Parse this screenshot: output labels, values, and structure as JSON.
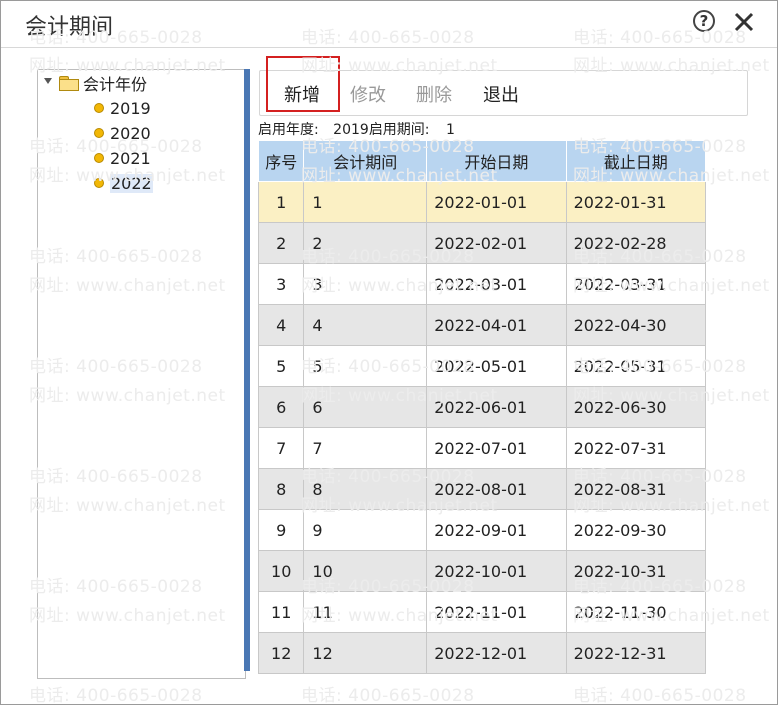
{
  "window": {
    "title": "会计期间",
    "help_icon": "question-circle-icon",
    "close_icon": "close-x-icon"
  },
  "watermark": {
    "phone": "电话: 400-665-0028",
    "site": "网址: www.chanjet.net"
  },
  "tree": {
    "root_label": "会计年份",
    "root_icon": "folder-icon",
    "year_icon": "yellow-dot-icon",
    "years": [
      "2019",
      "2020",
      "2021",
      "2022"
    ],
    "selected_year": "2022"
  },
  "toolbar": {
    "add_label": "新增",
    "edit_label": "修改",
    "delete_label": "删除",
    "exit_label": "退出",
    "highlight_color": "#d42020"
  },
  "info": {
    "start_year_label": "启用年度:",
    "start_year_value": "2019",
    "start_period_label": "启用期间:",
    "start_period_value": "1"
  },
  "table": {
    "headers": [
      "序号",
      "会计期间",
      "开始日期",
      "截止日期"
    ],
    "rows": [
      [
        "1",
        "1",
        "2022-01-01",
        "2022-01-31"
      ],
      [
        "2",
        "2",
        "2022-02-01",
        "2022-02-28"
      ],
      [
        "3",
        "3",
        "2022-03-01",
        "2022-03-31"
      ],
      [
        "4",
        "4",
        "2022-04-01",
        "2022-04-30"
      ],
      [
        "5",
        "5",
        "2022-05-01",
        "2022-05-31"
      ],
      [
        "6",
        "6",
        "2022-06-01",
        "2022-06-30"
      ],
      [
        "7",
        "7",
        "2022-07-01",
        "2022-07-31"
      ],
      [
        "8",
        "8",
        "2022-08-01",
        "2022-08-31"
      ],
      [
        "9",
        "9",
        "2022-09-01",
        "2022-09-30"
      ],
      [
        "10",
        "10",
        "2022-10-01",
        "2022-10-31"
      ],
      [
        "11",
        "11",
        "2022-11-01",
        "2022-11-30"
      ],
      [
        "12",
        "12",
        "2022-12-01",
        "2022-12-31"
      ]
    ],
    "selected_row": 1,
    "header_color": "#b9d5f0",
    "selected_color": "#fbf0c4"
  }
}
